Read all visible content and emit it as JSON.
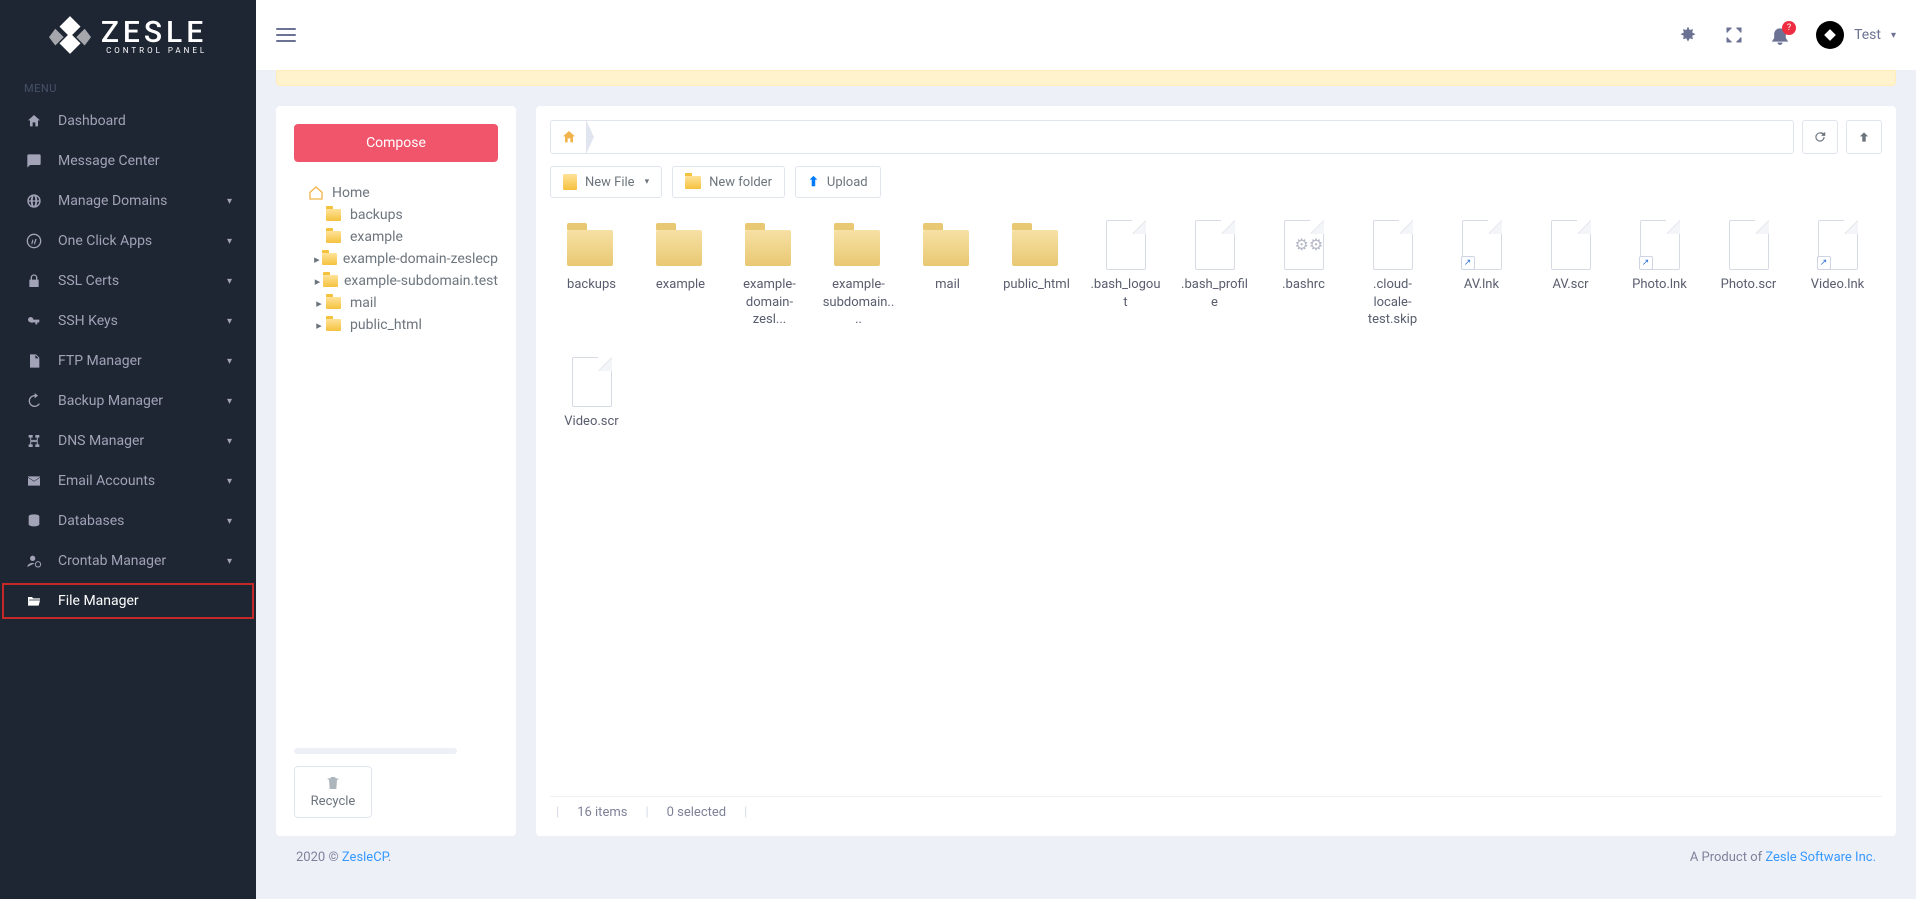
{
  "brand": {
    "name": "ZESLE",
    "tagline": "CONTROL PANEL"
  },
  "menuHeading": "MENU",
  "nav": {
    "dashboard": "Dashboard",
    "message_center": "Message Center",
    "manage_domains": "Manage Domains",
    "one_click_apps": "One Click Apps",
    "ssl_certs": "SSL Certs",
    "ssh_keys": "SSH Keys",
    "ftp_manager": "FTP Manager",
    "backup_manager": "Backup Manager",
    "dns_manager": "DNS Manager",
    "email_accounts": "Email Accounts",
    "databases": "Databases",
    "crontab_manager": "Crontab Manager",
    "file_manager": "File Manager"
  },
  "topbar": {
    "notif_badge": "?",
    "user": "Test"
  },
  "treePanel": {
    "compose": "Compose",
    "root": "Home",
    "nodes": {
      "backups": "backups",
      "example": "example",
      "example_domain": "example-domain-zeslecp",
      "example_sub": "example-subdomain.test",
      "mail": "mail",
      "public_html": "public_html"
    },
    "recycle": "Recycle"
  },
  "toolbar": {
    "new_file": "New File",
    "new_folder": "New folder",
    "upload": "Upload"
  },
  "files": [
    {
      "name": "backups",
      "type": "folder"
    },
    {
      "name": "example",
      "type": "folder"
    },
    {
      "name": "example-domain-zesl...",
      "type": "folder"
    },
    {
      "name": "example-subdomain....",
      "type": "folder"
    },
    {
      "name": "mail",
      "type": "folder"
    },
    {
      "name": "public_html",
      "type": "folder"
    },
    {
      "name": ".bash_logout",
      "type": "file"
    },
    {
      "name": ".bash_profile",
      "type": "file"
    },
    {
      "name": ".bashrc",
      "type": "gears"
    },
    {
      "name": ".cloud-locale-test.skip",
      "type": "file"
    },
    {
      "name": "AV.lnk",
      "type": "link"
    },
    {
      "name": "AV.scr",
      "type": "file"
    },
    {
      "name": "Photo.lnk",
      "type": "link"
    },
    {
      "name": "Photo.scr",
      "type": "file"
    },
    {
      "name": "Video.lnk",
      "type": "link"
    },
    {
      "name": "Video.scr",
      "type": "file"
    }
  ],
  "status": {
    "items": "16 items",
    "selected": "0 selected"
  },
  "footer": {
    "year": "2020 © ",
    "brandlink": "ZesleCP",
    "right_pre": "A Product of ",
    "right_link": "Zesle Software Inc."
  }
}
